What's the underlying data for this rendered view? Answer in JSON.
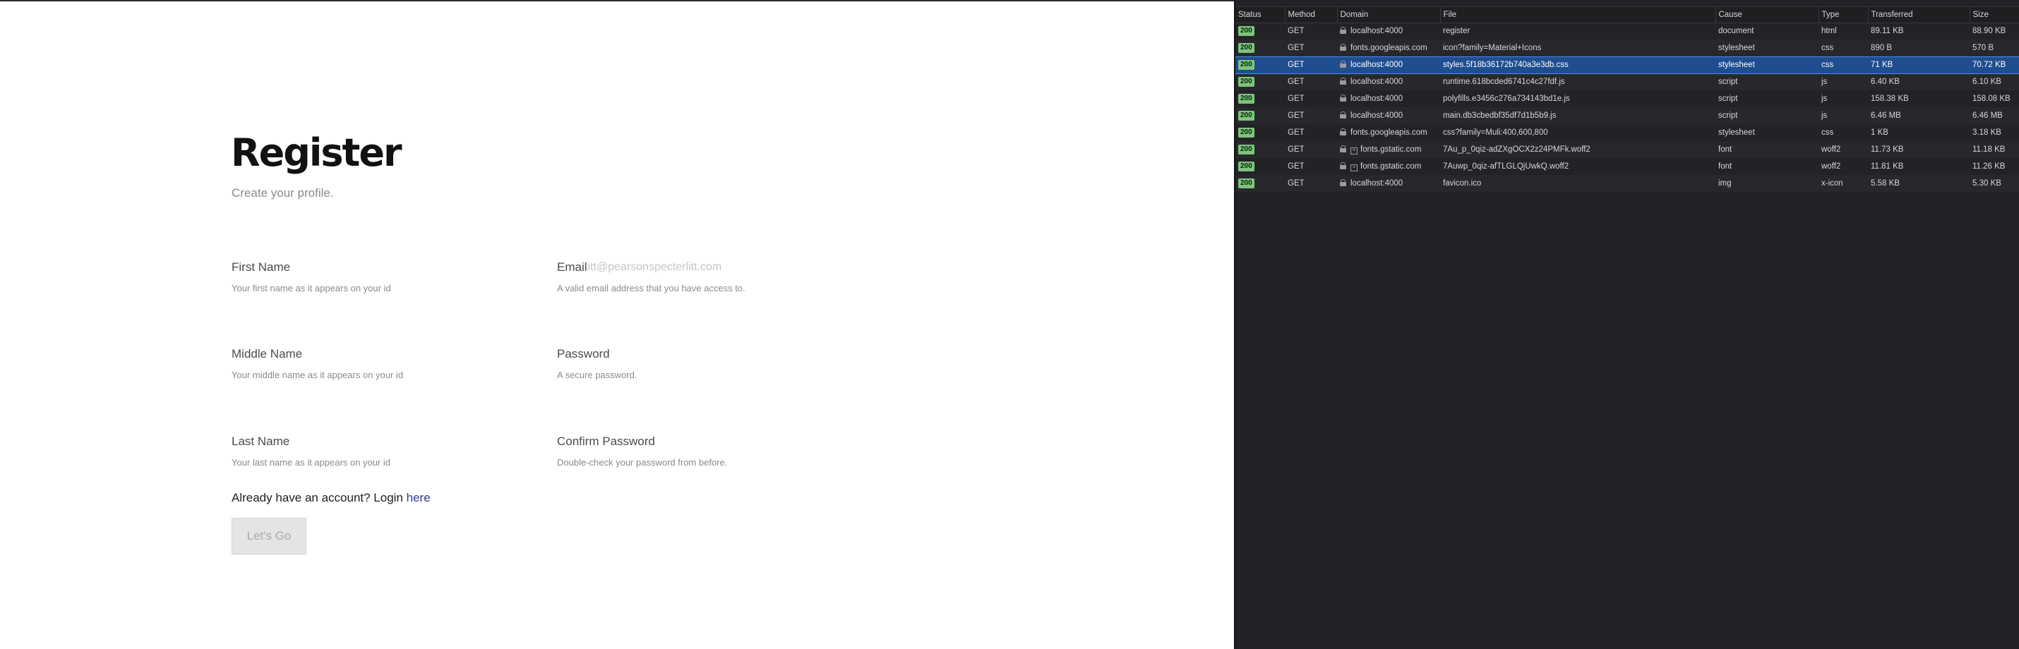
{
  "register": {
    "title": "Register",
    "subtitle": "Create your profile.",
    "fields": {
      "first_name": {
        "label": "First Name",
        "value": "",
        "placeholder": "",
        "hint": "Your first name as it appears on your id"
      },
      "middle_name": {
        "label": "Middle Name",
        "value": "",
        "placeholder": "",
        "hint": "Your middle name as it appears on your id"
      },
      "last_name": {
        "label": "Last Name",
        "value": "",
        "placeholder": "",
        "hint": "Your last name as it appears on your id"
      },
      "email": {
        "label": "Email",
        "value": "",
        "placeholder": "litt@pearsonspecterlitt.com",
        "hint": "A valid email address that you have access to."
      },
      "password": {
        "label": "Password",
        "value": "",
        "placeholder": "",
        "hint": "A secure password."
      },
      "confirm_password": {
        "label": "Confirm Password",
        "value": "",
        "placeholder": "",
        "hint": "Double-check your password from before."
      }
    },
    "login_prompt": "Already have an account? Login ",
    "login_link": "here",
    "submit_label": "Let's Go"
  },
  "network": {
    "columns": [
      "Status",
      "Method",
      "Domain",
      "File",
      "Cause",
      "Type",
      "Transferred",
      "Size"
    ],
    "rows": [
      {
        "status": "200",
        "method": "GET",
        "domain": "localhost:4000",
        "file": "register",
        "cause": "document",
        "type": "html",
        "transferred": "89.11 KB",
        "size": "88.90 KB",
        "selected": false,
        "tracker": false
      },
      {
        "status": "200",
        "method": "GET",
        "domain": "fonts.googleapis.com",
        "file": "icon?family=Material+Icons",
        "cause": "stylesheet",
        "type": "css",
        "transferred": "890 B",
        "size": "570 B",
        "selected": false,
        "tracker": false
      },
      {
        "status": "200",
        "method": "GET",
        "domain": "localhost:4000",
        "file": "styles.5f18b36172b740a3e3db.css",
        "cause": "stylesheet",
        "type": "css",
        "transferred": "71 KB",
        "size": "70.72 KB",
        "selected": true,
        "tracker": false
      },
      {
        "status": "200",
        "method": "GET",
        "domain": "localhost:4000",
        "file": "runtime.618bcded6741c4c27fdf.js",
        "cause": "script",
        "type": "js",
        "transferred": "6.40 KB",
        "size": "6.10 KB",
        "selected": false,
        "tracker": false
      },
      {
        "status": "200",
        "method": "GET",
        "domain": "localhost:4000",
        "file": "polyfills.e3456c276a734143bd1e.js",
        "cause": "script",
        "type": "js",
        "transferred": "158.38 KB",
        "size": "158.08 KB",
        "selected": false,
        "tracker": false
      },
      {
        "status": "200",
        "method": "GET",
        "domain": "localhost:4000",
        "file": "main.db3cbedbf35df7d1b5b9.js",
        "cause": "script",
        "type": "js",
        "transferred": "6.46 MB",
        "size": "6.46 MB",
        "selected": false,
        "tracker": false
      },
      {
        "status": "200",
        "method": "GET",
        "domain": "fonts.googleapis.com",
        "file": "css?family=Muli:400,600,800",
        "cause": "stylesheet",
        "type": "css",
        "transferred": "1 KB",
        "size": "3.18 KB",
        "selected": false,
        "tracker": false
      },
      {
        "status": "200",
        "method": "GET",
        "domain": "fonts.gstatic.com",
        "file": "7Au_p_0qiz-adZXgOCX2z24PMFk.woff2",
        "cause": "font",
        "type": "woff2",
        "transferred": "11.73 KB",
        "size": "11.18 KB",
        "selected": false,
        "tracker": true
      },
      {
        "status": "200",
        "method": "GET",
        "domain": "fonts.gstatic.com",
        "file": "7Auwp_0qiz-afTLGLQjUwkQ.woff2",
        "cause": "font",
        "type": "woff2",
        "transferred": "11.81 KB",
        "size": "11.26 KB",
        "selected": false,
        "tracker": true
      },
      {
        "status": "200",
        "method": "GET",
        "domain": "localhost:4000",
        "file": "favicon.ico",
        "cause": "img",
        "type": "x-icon",
        "transferred": "5.58 KB",
        "size": "5.30 KB",
        "selected": false,
        "tracker": false
      }
    ]
  }
}
